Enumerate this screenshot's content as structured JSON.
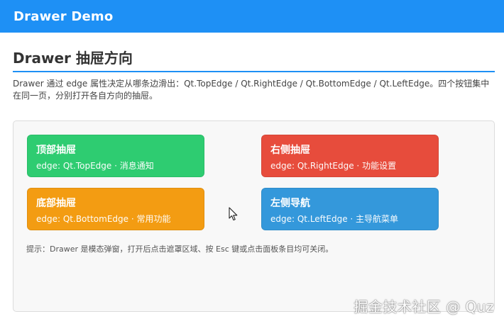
{
  "app": {
    "title": "Drawer Demo"
  },
  "header": {
    "title": "Drawer 抽屉方向"
  },
  "description": "Drawer 通过 edge 属性决定从哪条边滑出：Qt.TopEdge / Qt.RightEdge / Qt.BottomEdge / Qt.LeftEdge。四个按钮集中在同一页，分别打开各自方向的抽屉。",
  "buttons": [
    {
      "title": "顶部抽屉",
      "subtitle": "edge: Qt.TopEdge · 消息通知",
      "color": "#2ecc71"
    },
    {
      "title": "右侧抽屉",
      "subtitle": "edge: Qt.RightEdge · 功能设置",
      "color": "#e74c3c"
    },
    {
      "title": "底部抽屉",
      "subtitle": "edge: Qt.BottomEdge · 常用功能",
      "color": "#f39c12"
    },
    {
      "title": "左侧导航",
      "subtitle": "edge: Qt.LeftEdge · 主导航菜单",
      "color": "#3498db"
    }
  ],
  "hint": "提示：Drawer 是模态弹窗，打开后点击遮罩区域、按 Esc 键或点击面板条目均可关闭。",
  "watermark": "掘金技术社区 @ Quz"
}
